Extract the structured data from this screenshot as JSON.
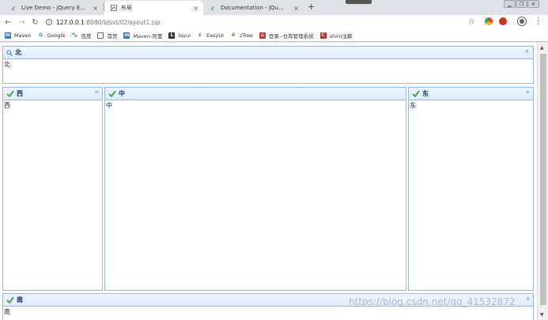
{
  "browser": {
    "tabs": [
      {
        "title": "Live Demo - jQuery EasyUI",
        "close": "×"
      },
      {
        "title": "布局",
        "close": "×"
      },
      {
        "title": "Documentation - jQuery EasyU",
        "close": "×"
      }
    ],
    "new_tab": "+",
    "url_host": "127.0.0.1",
    "url_path": ":8080/bjsxt/02layout1.jsp",
    "bookmarks": [
      {
        "label": "Maven",
        "icon": "maven-icon",
        "color": "#2e7bcf"
      },
      {
        "label": "Google",
        "icon": "google-icon",
        "color": "#4285f4"
      },
      {
        "label": "百度",
        "icon": "baidu-icon",
        "color": "#2932e1"
      },
      {
        "label": "首页",
        "icon": "home-page-icon",
        "color": "#666666"
      },
      {
        "label": "Maven-阿里",
        "icon": "maven-aliyun-icon",
        "color": "#2e7bcf"
      },
      {
        "label": "layui",
        "icon": "layui-icon",
        "color": "#333333"
      },
      {
        "label": "EasyUI",
        "icon": "easyui-icon",
        "color": "#3a5ba0"
      },
      {
        "label": "zTree",
        "icon": "ztree-icon",
        "color": "#7a9c3b"
      },
      {
        "label": "登录--仓库管理系统",
        "icon": "warehouse-icon",
        "color": "#d93025"
      },
      {
        "label": "shiro注解",
        "icon": "shiro-icon",
        "color": "#c62828"
      }
    ]
  },
  "layout": {
    "north": {
      "title": "北",
      "content": "北",
      "collapse": "»"
    },
    "west": {
      "title": "西",
      "content": "西",
      "collapse": "«"
    },
    "center": {
      "title": "中",
      "content": "中"
    },
    "east": {
      "title": "东",
      "content": "东",
      "collapse": "»"
    },
    "south": {
      "title": "南",
      "content": "南",
      "collapse": "»"
    }
  },
  "watermark": "https://blog.csdn.net/qq_41532872",
  "colors": {
    "panel_border": "#95b8e7",
    "header_top": "#eff5ff",
    "header_bottom": "#e0ecff",
    "title_text": "#0e2d5f"
  }
}
